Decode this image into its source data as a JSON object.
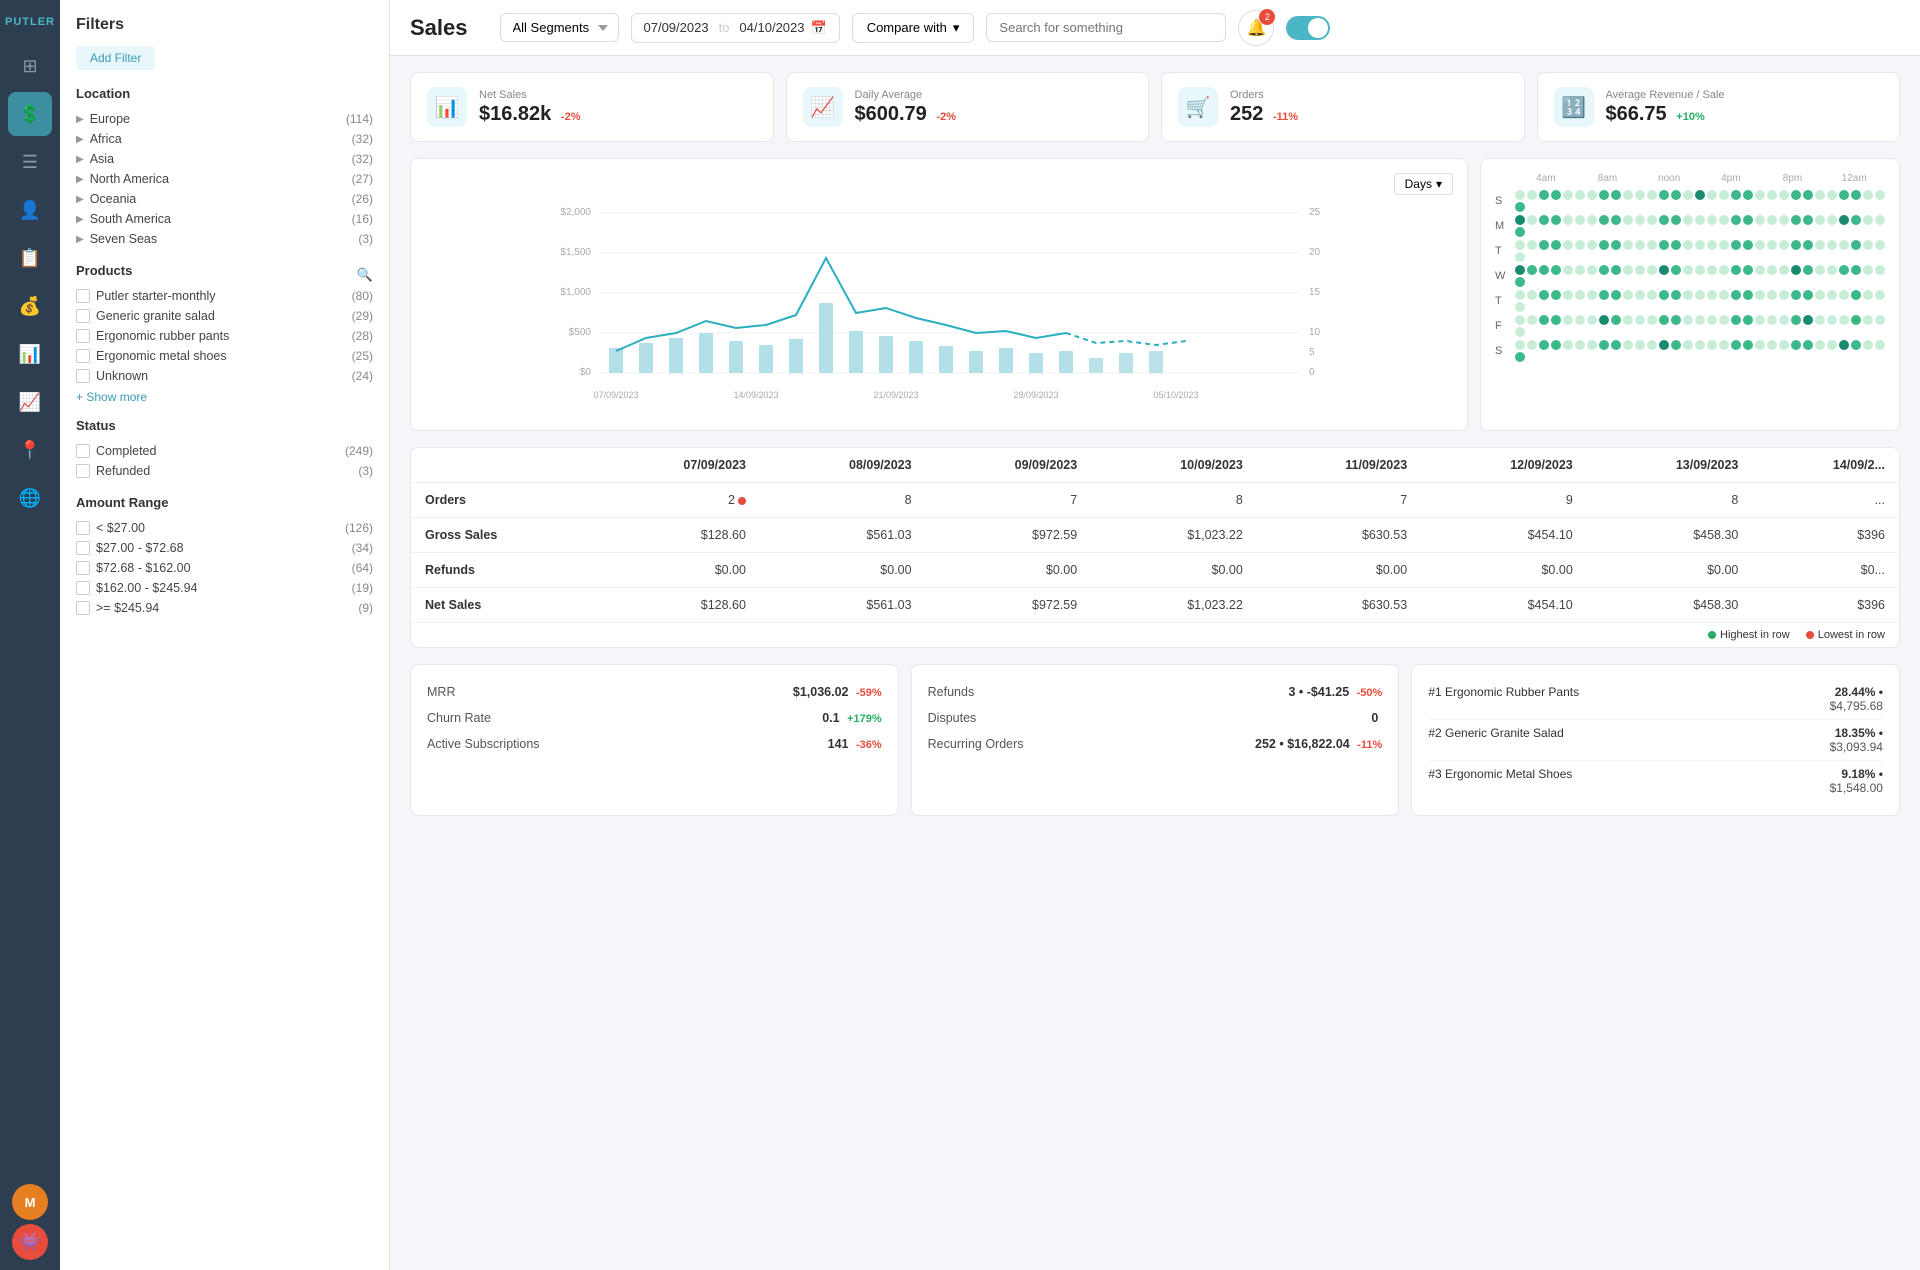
{
  "app": {
    "logo": "PUTLER",
    "title": "Sales"
  },
  "topbar": {
    "segment": "All Segments",
    "date_from": "07/09/2023",
    "date_to": "04/10/2023",
    "compare_label": "Compare with",
    "search_placeholder": "Search for something",
    "notif_count": "2"
  },
  "kpis": [
    {
      "label": "Net Sales",
      "value": "$16.82k",
      "change": "-2%",
      "type": "neg",
      "icon": "📊"
    },
    {
      "label": "Daily Average",
      "value": "$600.79",
      "change": "-2%",
      "type": "neg",
      "icon": "📈"
    },
    {
      "label": "Orders",
      "value": "252",
      "change": "-11%",
      "type": "neg",
      "icon": "🛒"
    },
    {
      "label": "Average Revenue / Sale",
      "value": "$66.75",
      "change": "+10%",
      "type": "pos",
      "icon": "🔢"
    }
  ],
  "chart": {
    "days_btn": "Days",
    "y_labels": [
      "$2,000",
      "$1,500",
      "$1,000",
      "$500",
      "$0"
    ],
    "y_right": [
      "25",
      "20",
      "15",
      "10",
      "5",
      "0"
    ],
    "x_labels": [
      "07/09/2023",
      "14/09/2023",
      "21/09/2023",
      "28/09/2023",
      "05/10/2023"
    ]
  },
  "dot_matrix": {
    "time_labels": [
      "4am",
      "8am",
      "noon",
      "4pm",
      "8pm",
      "12am"
    ],
    "rows": [
      {
        "label": "S",
        "dots": [
          0,
          0,
          1,
          1,
          0,
          0,
          0,
          1,
          1,
          0,
          0,
          0,
          1,
          1,
          0,
          2,
          0,
          0,
          1,
          1,
          0,
          0,
          0,
          1,
          1,
          0,
          0,
          1,
          1,
          0,
          0,
          1
        ]
      },
      {
        "label": "M",
        "dots": [
          2,
          0,
          1,
          1,
          0,
          0,
          0,
          1,
          1,
          0,
          0,
          0,
          1,
          1,
          0,
          0,
          0,
          0,
          1,
          1,
          0,
          0,
          0,
          1,
          1,
          0,
          0,
          2,
          1,
          0,
          0,
          1
        ]
      },
      {
        "label": "T",
        "dots": [
          0,
          0,
          1,
          1,
          0,
          0,
          0,
          1,
          1,
          0,
          0,
          0,
          1,
          1,
          0,
          0,
          0,
          0,
          1,
          1,
          0,
          0,
          0,
          1,
          1,
          0,
          0,
          0,
          1,
          0,
          0,
          0
        ]
      },
      {
        "label": "W",
        "dots": [
          2,
          1,
          1,
          1,
          0,
          0,
          0,
          1,
          1,
          0,
          0,
          0,
          2,
          1,
          0,
          0,
          0,
          0,
          1,
          1,
          0,
          0,
          0,
          2,
          1,
          0,
          0,
          1,
          1,
          0,
          0,
          1
        ]
      },
      {
        "label": "T",
        "dots": [
          0,
          0,
          1,
          1,
          0,
          0,
          0,
          1,
          1,
          0,
          0,
          0,
          1,
          1,
          0,
          0,
          0,
          0,
          1,
          1,
          0,
          0,
          0,
          1,
          1,
          0,
          0,
          0,
          1,
          0,
          0,
          0
        ]
      },
      {
        "label": "F",
        "dots": [
          0,
          0,
          1,
          1,
          0,
          0,
          0,
          2,
          1,
          0,
          0,
          0,
          1,
          1,
          0,
          0,
          0,
          0,
          1,
          1,
          0,
          0,
          0,
          1,
          2,
          0,
          0,
          0,
          1,
          0,
          0,
          0
        ]
      },
      {
        "label": "S",
        "dots": [
          0,
          0,
          1,
          1,
          0,
          0,
          0,
          1,
          1,
          0,
          0,
          0,
          2,
          1,
          0,
          0,
          0,
          0,
          1,
          1,
          0,
          0,
          0,
          1,
          1,
          0,
          0,
          2,
          1,
          0,
          0,
          1
        ]
      }
    ]
  },
  "table": {
    "columns": [
      "07/09/2023",
      "08/09/2023",
      "09/09/2023",
      "10/09/2023",
      "11/09/2023",
      "12/09/2023",
      "13/09/2023",
      "14/09/2..."
    ],
    "rows": [
      {
        "label": "Orders",
        "values": [
          "2",
          "8",
          "7",
          "8",
          "7",
          "9",
          "8",
          "..."
        ],
        "has_dot": true
      },
      {
        "label": "Gross Sales",
        "values": [
          "$128.60",
          "$561.03",
          "$972.59",
          "$1,023.22",
          "$630.53",
          "$454.10",
          "$458.30",
          "$396"
        ]
      },
      {
        "label": "Refunds",
        "values": [
          "$0.00",
          "$0.00",
          "$0.00",
          "$0.00",
          "$0.00",
          "$0.00",
          "$0.00",
          "$0..."
        ]
      },
      {
        "label": "Net Sales",
        "values": [
          "$128.60",
          "$561.03",
          "$972.59",
          "$1,023.22",
          "$630.53",
          "$454.10",
          "$458.30",
          "$396"
        ]
      }
    ],
    "legend_high": "Highest in row",
    "legend_low": "Lowest in row"
  },
  "filters": {
    "title": "Filters",
    "add_filter": "Add Filter",
    "location": {
      "title": "Location",
      "items": [
        {
          "name": "Europe",
          "count": 114
        },
        {
          "name": "Africa",
          "count": 32
        },
        {
          "name": "Asia",
          "count": 32
        },
        {
          "name": "North America",
          "count": 27
        },
        {
          "name": "Oceania",
          "count": 26
        },
        {
          "name": "South America",
          "count": 16
        },
        {
          "name": "Seven Seas",
          "count": 3
        }
      ]
    },
    "products": {
      "title": "Products",
      "items": [
        {
          "name": "Putler starter-monthly",
          "count": 80
        },
        {
          "name": "Generic granite salad",
          "count": 29
        },
        {
          "name": "Ergonomic rubber pants",
          "count": 28
        },
        {
          "name": "Ergonomic metal shoes",
          "count": 25
        },
        {
          "name": "Unknown",
          "count": 24
        }
      ],
      "show_more": "+ Show more"
    },
    "status": {
      "title": "Status",
      "items": [
        {
          "name": "Completed",
          "count": 249
        },
        {
          "name": "Refunded",
          "count": 3
        }
      ]
    },
    "amount": {
      "title": "Amount Range",
      "items": [
        {
          "name": "< $27.00",
          "count": 126
        },
        {
          "name": "$27.00 - $72.68",
          "count": 34
        },
        {
          "name": "$72.68 - $162.00",
          "count": 64
        },
        {
          "name": "$162.00 - $245.94",
          "count": 19
        },
        {
          "name": ">= $245.94",
          "count": 9
        }
      ]
    }
  },
  "summary": {
    "left": {
      "rows": [
        {
          "label": "MRR",
          "value": "$1,036.02",
          "change": "-59%",
          "type": "neg"
        },
        {
          "label": "Churn Rate",
          "value": "0.1",
          "change": "+179%",
          "type": "pos"
        },
        {
          "label": "Active Subscriptions",
          "value": "141",
          "change": "-36%",
          "type": "neg"
        }
      ]
    },
    "mid": {
      "rows": [
        {
          "label": "Refunds",
          "value": "3 • -$41.25",
          "change": "-50%",
          "type": "neg"
        },
        {
          "label": "Disputes",
          "value": "0",
          "change": "",
          "type": ""
        },
        {
          "label": "Recurring Orders",
          "value": "252 • $16,822.04",
          "change": "-11%",
          "type": "neg"
        }
      ]
    },
    "right": {
      "items": [
        {
          "rank": "#1",
          "name": "Ergonomic Rubber Pants",
          "pct": "28.44%",
          "revenue": "$4,795.68"
        },
        {
          "rank": "#2",
          "name": "Generic Granite Salad",
          "pct": "18.35%",
          "revenue": "$3,093.94"
        },
        {
          "rank": "#3",
          "name": "Ergonomic Metal Shoes",
          "pct": "9.18%",
          "revenue": "$1,548.00"
        }
      ]
    }
  }
}
